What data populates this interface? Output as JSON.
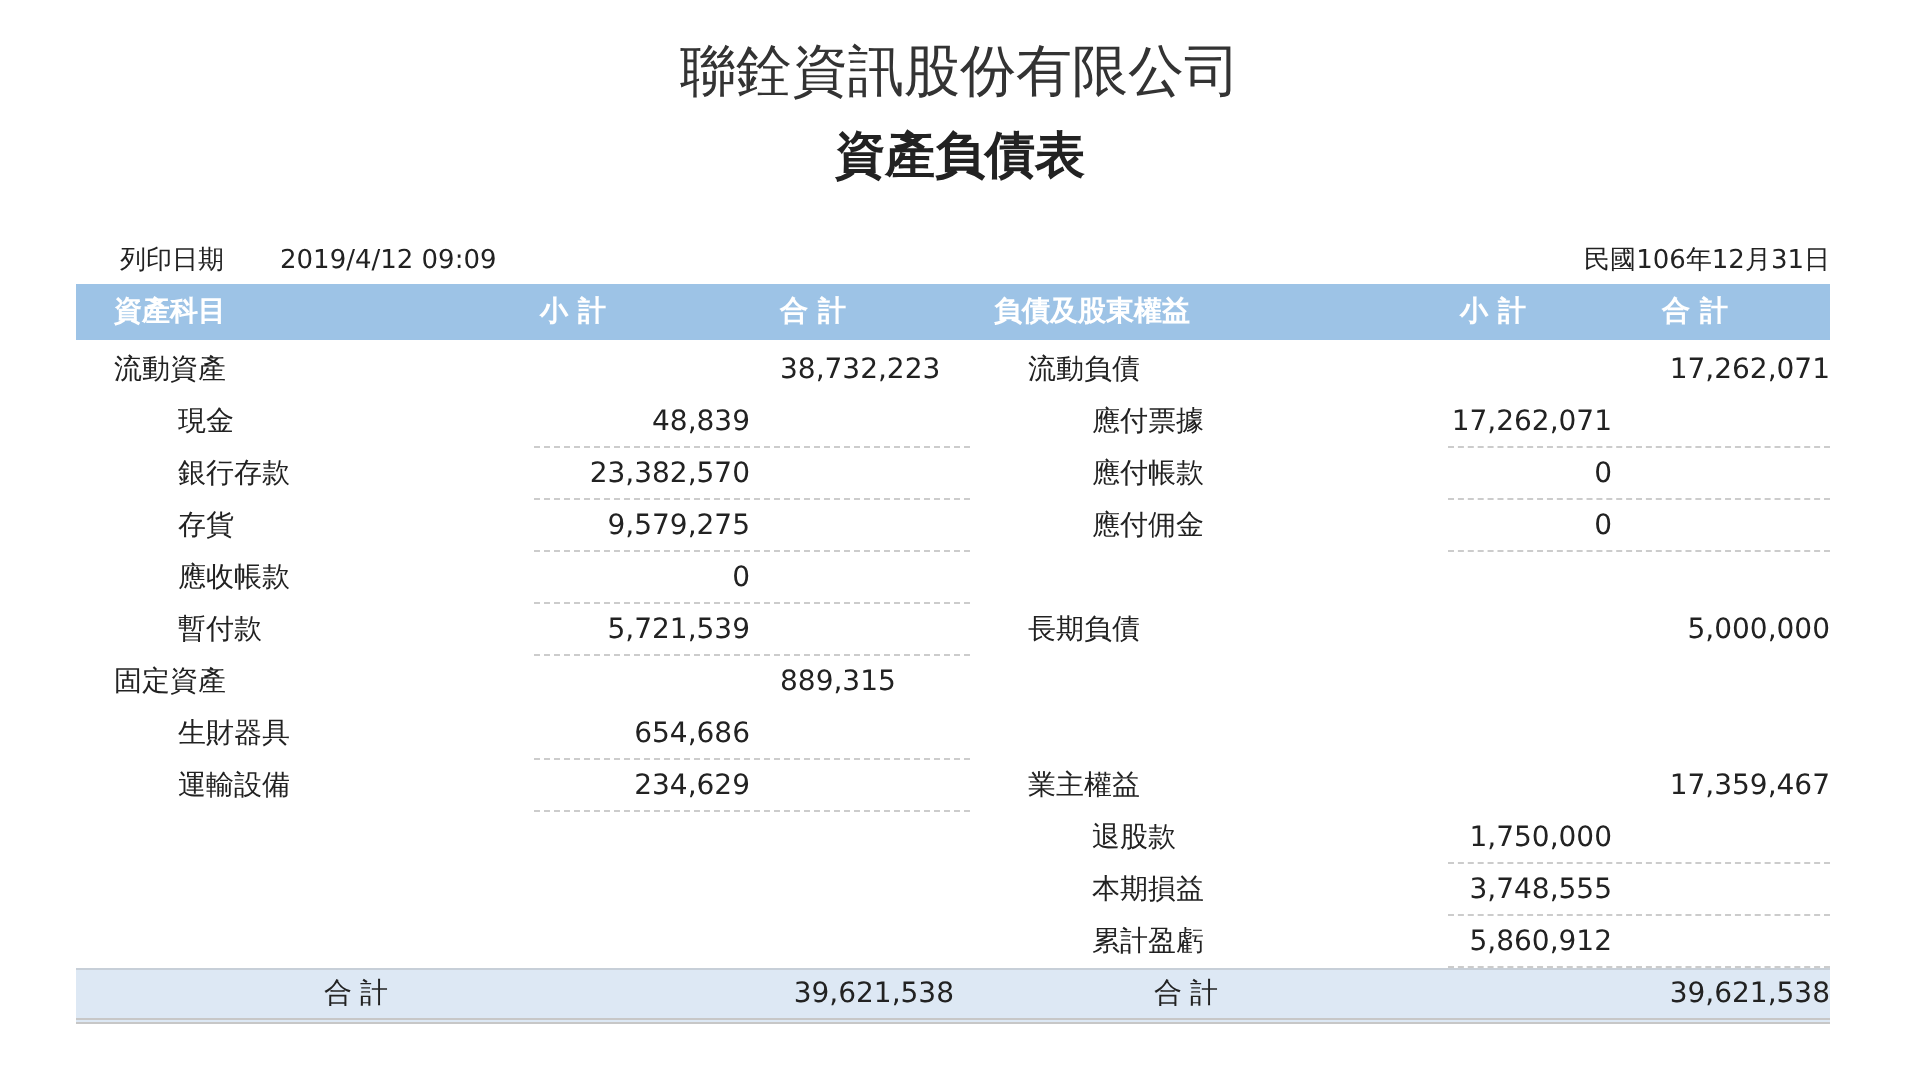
{
  "company": "聯銓資訊股份有限公司",
  "report_title": "資產負債表",
  "print_label": "列印日期",
  "print_date": "2019/4/12 09:09",
  "period": "民國106年12月31日",
  "left": {
    "headers": [
      "資產科目",
      "小 計",
      "合 計"
    ],
    "rows": [
      {
        "kind": "group",
        "label": "流動資產",
        "total": "38,732,223"
      },
      {
        "kind": "item",
        "label": "現金",
        "subtotal": "48,839"
      },
      {
        "kind": "item",
        "label": "銀行存款",
        "subtotal": "23,382,570"
      },
      {
        "kind": "item",
        "label": "存貨",
        "subtotal": "9,579,275"
      },
      {
        "kind": "item",
        "label": "應收帳款",
        "subtotal": "0"
      },
      {
        "kind": "item",
        "label": "暫付款",
        "subtotal": "5,721,539"
      },
      {
        "kind": "group",
        "label": "固定資產",
        "total": "889,315"
      },
      {
        "kind": "item",
        "label": "生財器具",
        "subtotal": "654,686"
      },
      {
        "kind": "item",
        "label": "運輸設備",
        "subtotal": "234,629"
      }
    ],
    "footer_label": "合 計",
    "footer_total": "39,621,538"
  },
  "right": {
    "headers": [
      "負債及股東權益",
      "小 計",
      "合 計"
    ],
    "rows": [
      {
        "kind": "group",
        "label": "流動負債",
        "total": "17,262,071"
      },
      {
        "kind": "item",
        "label": "應付票據",
        "subtotal": "17,262,071"
      },
      {
        "kind": "item",
        "label": "應付帳款",
        "subtotal": "0"
      },
      {
        "kind": "item",
        "label": "應付佣金",
        "subtotal": "0"
      },
      {
        "kind": "blank"
      },
      {
        "kind": "group",
        "label": "長期負債",
        "total": "5,000,000"
      },
      {
        "kind": "blank"
      },
      {
        "kind": "blank"
      },
      {
        "kind": "group",
        "label": "業主權益",
        "total": "17,359,467"
      },
      {
        "kind": "item",
        "label": "退股款",
        "subtotal": "1,750,000"
      },
      {
        "kind": "item",
        "label": "本期損益",
        "subtotal": "3,748,555"
      },
      {
        "kind": "item",
        "label": "累計盈虧",
        "subtotal": "5,860,912"
      }
    ],
    "footer_label": "合 計",
    "footer_total": "39,621,538"
  }
}
